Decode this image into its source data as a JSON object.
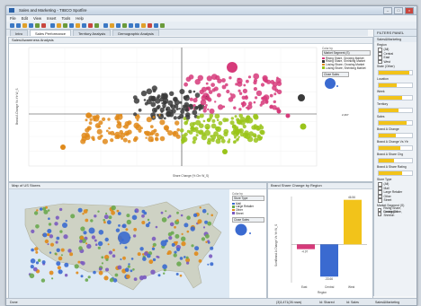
{
  "window": {
    "title": "Sales and Marketing - TIBCO Spotfire"
  },
  "menu": [
    "File",
    "Edit",
    "View",
    "Insert",
    "Tools",
    "Help"
  ],
  "tabs": [
    "Intro",
    "Sales Performance",
    "Territory Analysis",
    "Demographic Analysis"
  ],
  "active_tab": 1,
  "toolbar_colors": [
    "#3b78c4",
    "#3b78c4",
    "#e0a02a",
    "#3b78c4",
    "#6a9a3a",
    "#c8463e",
    "#3b78c4",
    "#e0a02a",
    "#6a9a3a",
    "#3b78c4",
    "#e0a02a",
    "#3b78c4",
    "#c8463e",
    "#6a9a3a",
    "#3b78c4",
    "#e0a02a",
    "#3b78c4",
    "#6a9a3a",
    "#3b78c4",
    "#3b78c4",
    "#e0a02a",
    "#c8463e",
    "#3b78c4",
    "#6a9a3a"
  ],
  "scatter": {
    "title": "Sales/Awareness Analysis",
    "xlabel": "Share Change (% Chr W_S)",
    "ylabel": "Brand A Change Vs Ytr W_S",
    "legend_title": "Market Segment (S)",
    "legend": [
      {
        "label": "Rising Share, Growing Market",
        "color": "#d63a7a"
      },
      {
        "label": "Rising Share, Shrinking Market",
        "color": "#3a3a3a"
      },
      {
        "label": "Losing Share, Growing Market",
        "color": "#e08a1a"
      },
      {
        "label": "Losing Share, Shrinking Market",
        "color": "#9ac41a"
      }
    ],
    "size_label": "Close Sales",
    "size_value": "2,467"
  },
  "map": {
    "title": "Map of US Stores",
    "color_by": "Color by",
    "store_type_label": "Store Type",
    "legend": [
      {
        "label": "Mall",
        "color": "#3a6ad0"
      },
      {
        "label": "Large Retailer",
        "color": "#6aa84f"
      },
      {
        "label": "Other",
        "color": "#e08a1a"
      },
      {
        "label": "Street",
        "color": "#7a5ac0"
      }
    ],
    "size_label": "Close Sales",
    "size_value": "2,467"
  },
  "bars": {
    "title": "Brand Share Change by Region",
    "ylabel": "SumBrand A Change Vs Ytr W_S",
    "xlabel": "Region",
    "bar_labels": [
      "-4.97",
      "-33.66",
      "46.56"
    ],
    "categories": [
      "East",
      "Central",
      "West"
    ]
  },
  "filters": {
    "header": "FILTERS PANEL",
    "sub": "Sales&Marketing",
    "region_label": "Region",
    "regions": [
      "(All)",
      "Central",
      "East",
      "West"
    ],
    "items": [
      {
        "label": "State (Other)",
        "fill": 0.92
      },
      {
        "label": "Location",
        "fill": 0.55
      },
      {
        "label": "Week",
        "fill": 0.7
      },
      {
        "label": "Territory",
        "fill": 0.6
      },
      {
        "label": "Sales",
        "fill": 0.85
      },
      {
        "label": "Brand A Change",
        "fill": 0.5
      },
      {
        "label": "Brand A Change Vs Ytr",
        "fill": 0.65
      },
      {
        "label": "Brand A Share Chg",
        "fill": 0.45
      },
      {
        "label": "Brand A Share Rating",
        "fill": 0.7
      }
    ],
    "store_type_label": "Store Type",
    "store_types": [
      "(All)",
      "Mall",
      "Large Retailer",
      "Other",
      "Street"
    ],
    "market_segment_label": "Market Segment (S)",
    "segments": [
      "Rising Share, Growing M",
      "Losing Share, Shrinkin"
    ]
  },
  "status": {
    "left": "Done",
    "right": [
      "(3)3,471(26 rows)",
      "Id: Shared",
      "Id: Sales",
      "Sales&Marketing"
    ]
  }
}
